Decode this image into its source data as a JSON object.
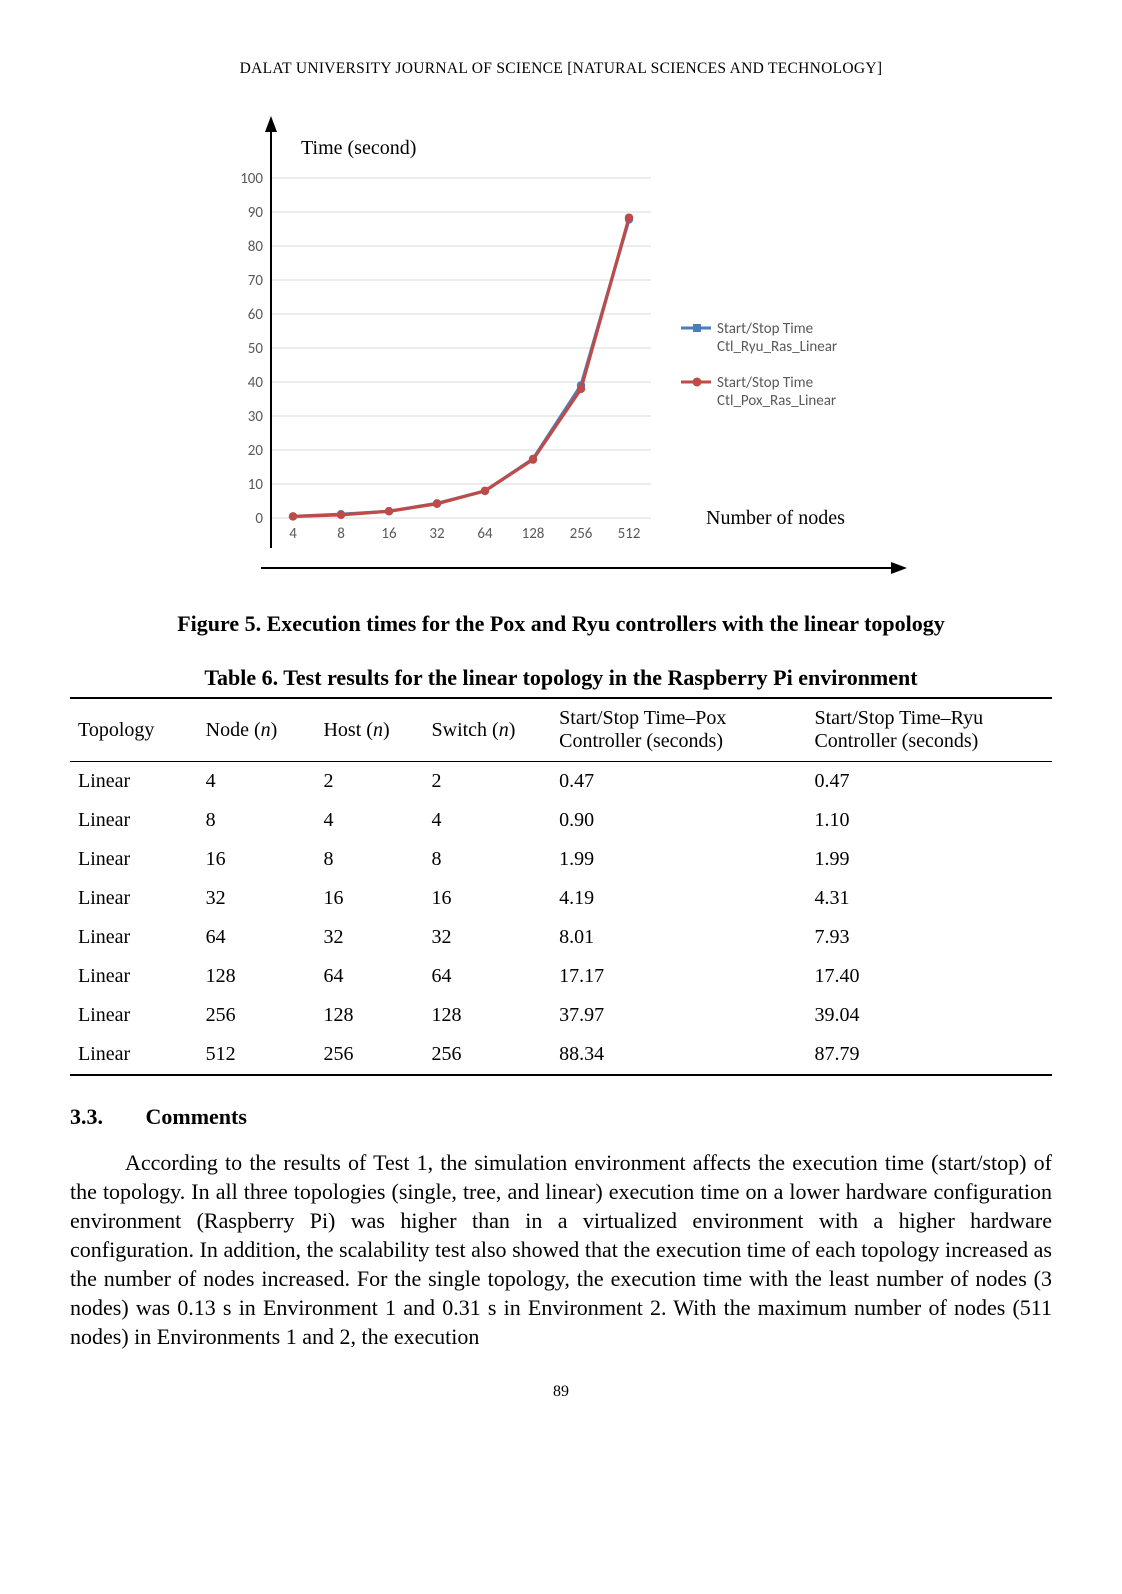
{
  "header": "DALAT UNIVERSITY JOURNAL OF SCIENCE [NATURAL SCIENCES AND TECHNOLOGY]",
  "figure_caption": "Figure 5. Execution times for the Pox and Ryu controllers with the linear topology",
  "table_caption": "Table 6. Test results for the linear topology in the Raspberry Pi environment",
  "chart_data": {
    "type": "line",
    "title": "",
    "ylabel": "Time (second)",
    "xlabel": "Number of nodes",
    "categories": [
      "4",
      "8",
      "16",
      "32",
      "64",
      "128",
      "256",
      "512"
    ],
    "yticks": [
      0,
      10,
      20,
      30,
      40,
      50,
      60,
      70,
      80,
      90,
      100
    ],
    "ylim": [
      0,
      100
    ],
    "series": [
      {
        "name": "Start/Stop Time Ctl_Ryu_Ras_Linear",
        "color": "#4a7ebb",
        "values": [
          0.47,
          1.1,
          1.99,
          4.31,
          7.93,
          17.4,
          39.04,
          87.79
        ]
      },
      {
        "name": "Start/Stop Time Ctl_Pox_Ras_Linear",
        "color": "#be4b48",
        "values": [
          0.47,
          0.9,
          1.99,
          4.19,
          8.01,
          17.17,
          37.97,
          88.34
        ]
      }
    ],
    "legend_lines": {
      "s0": [
        "Start/Stop Time",
        "Ctl_Ryu_Ras_Linear"
      ],
      "s1": [
        "Start/Stop Time",
        "Ctl_Pox_Ras_Linear"
      ]
    }
  },
  "table": {
    "headers": [
      "Topology",
      "Node (n)",
      "Host (n)",
      "Switch (n)",
      "Start/Stop Time–Pox Controller (seconds)",
      "Start/Stop Time–Ryu Controller (seconds)"
    ],
    "header_html": {
      "node": "Node (<i>n</i>)",
      "host": "Host (<i>n</i>)",
      "switch": "Switch (<i>n</i>)"
    },
    "rows": [
      [
        "Linear",
        "4",
        "2",
        "2",
        "0.47",
        "0.47"
      ],
      [
        "Linear",
        "8",
        "4",
        "4",
        "0.90",
        "1.10"
      ],
      [
        "Linear",
        "16",
        "8",
        "8",
        "1.99",
        "1.99"
      ],
      [
        "Linear",
        "32",
        "16",
        "16",
        "4.19",
        "4.31"
      ],
      [
        "Linear",
        "64",
        "32",
        "32",
        "8.01",
        "7.93"
      ],
      [
        "Linear",
        "128",
        "64",
        "64",
        "17.17",
        "17.40"
      ],
      [
        "Linear",
        "256",
        "128",
        "128",
        "37.97",
        "39.04"
      ],
      [
        "Linear",
        "512",
        "256",
        "256",
        "88.34",
        "87.79"
      ]
    ]
  },
  "section": {
    "number": "3.3.",
    "title": "Comments"
  },
  "paragraph": "According to the results of Test 1, the simulation environment affects the execution time (start/stop) of the topology. In all three topologies (single, tree, and linear) execution time on a lower hardware configuration environment (Raspberry Pi) was higher than in a virtualized environment with a higher hardware configuration. In addition, the scalability test also showed that the execution time of each topology increased as the number of nodes increased. For the single topology, the execution time with the least number of nodes (3 nodes) was 0.13 s in Environment 1 and 0.31 s in Environment 2. With the maximum number of nodes (511 nodes) in Environments 1 and 2, the execution",
  "page_number": "89"
}
